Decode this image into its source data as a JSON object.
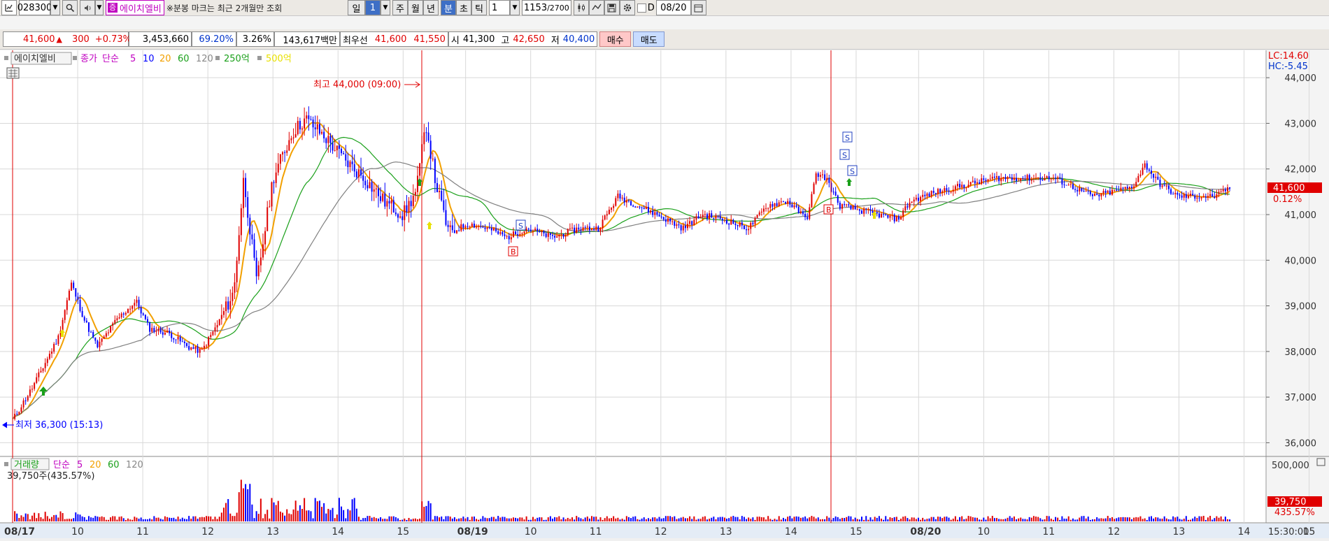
{
  "toolbar": {
    "code": "028300",
    "name": "에이치엘비",
    "notice": "※분봉 마크는 최근 2개월만 조회",
    "period_day": "일",
    "period_num": "1",
    "period_week": "주",
    "period_month": "월",
    "period_year": "년",
    "period_min": "분",
    "period_sec": "초",
    "period_tick": "틱",
    "interval_value": "1",
    "count": "1153",
    "count_total": "/2700",
    "d_label": "D",
    "date": "08/20"
  },
  "quote": {
    "price": "41,600",
    "up_arrow": "▲",
    "change": "300",
    "change_pct": "+0.73%",
    "volume": "3,453,660",
    "vol_ratio": "69.20%",
    "turnover": "3.26%",
    "amount": "143,617백만",
    "best_label": "최우선",
    "best_ask": "41,600",
    "best_bid": "41,550",
    "open_label": "시",
    "open": "41,300",
    "high_label": "고",
    "high": "42,650",
    "low_label": "저",
    "low": "40,400",
    "buy_button": "매수",
    "sell_button": "매도"
  },
  "price_legend": {
    "name": "에이치엘비",
    "close_label": "종가",
    "simple": "단순",
    "ma5": "5",
    "ma10": "10",
    "ma20": "20",
    "ma60": "60",
    "ma120": "120",
    "ma250": "250억",
    "ma500": "500억"
  },
  "volume_legend": {
    "title": "거래량",
    "simple": "단순",
    "ma5": "5",
    "ma20": "20",
    "ma60": "60",
    "ma120": "120",
    "value": "39,750주(435.57%)"
  },
  "annotations": {
    "high": "최고 44,000 (09:00)",
    "low": "최저 36,300 (15:13)",
    "lc": "LC:14.60",
    "hc": "HC:-5.45",
    "current_price": "41,600",
    "current_pct": "0.12%",
    "vol_current": "39,750",
    "vol_pct": "435.57%",
    "vol_axis_max": "500,000",
    "time_corner": "15:30:00"
  },
  "colors": {
    "up": "#e00000",
    "down": "#0000ff",
    "ma5": "#f2a000",
    "ma20": "#1aa01a",
    "ma60": "#808080",
    "grid": "#d8d8d8"
  },
  "chart_data": {
    "type": "line",
    "title": "",
    "price_axis": {
      "ticks": [
        "44,000",
        "43,000",
        "42,000",
        "41,000",
        "40,000",
        "39,000",
        "38,000",
        "37,000",
        "36,000"
      ],
      "tick_values": [
        44000,
        43000,
        42000,
        41000,
        40000,
        39000,
        38000,
        37000,
        36000
      ],
      "ylim": [
        35700,
        44600
      ]
    },
    "time_axis": {
      "labels": [
        "08/17",
        "10",
        "11",
        "12",
        "13",
        "14",
        "15",
        "08/19",
        "10",
        "11",
        "12",
        "13",
        "14",
        "15",
        "08/20",
        "10",
        "11",
        "12",
        "13",
        "14",
        "15"
      ],
      "day_starts": [
        "08/17",
        "08/19",
        "08/20"
      ]
    },
    "series_prices": [
      {
        "x": 0,
        "y": 36500
      },
      {
        "x": 0.3,
        "y": 37200
      },
      {
        "x": 0.7,
        "y": 38300
      },
      {
        "x": 0.9,
        "y": 39500
      },
      {
        "x": 1.1,
        "y": 38700
      },
      {
        "x": 1.3,
        "y": 38100
      },
      {
        "x": 1.6,
        "y": 38700
      },
      {
        "x": 1.9,
        "y": 39100
      },
      {
        "x": 2.1,
        "y": 38500
      },
      {
        "x": 2.4,
        "y": 38400
      },
      {
        "x": 2.7,
        "y": 38100
      },
      {
        "x": 2.9,
        "y": 38000
      },
      {
        "x": 3.15,
        "y": 38600
      },
      {
        "x": 3.4,
        "y": 39300
      },
      {
        "x": 3.55,
        "y": 41800
      },
      {
        "x": 3.75,
        "y": 39500
      },
      {
        "x": 4.0,
        "y": 41800
      },
      {
        "x": 4.3,
        "y": 42800
      },
      {
        "x": 4.5,
        "y": 43100
      },
      {
        "x": 4.8,
        "y": 42700
      },
      {
        "x": 5.1,
        "y": 42200
      },
      {
        "x": 5.4,
        "y": 41800
      },
      {
        "x": 5.7,
        "y": 41300
      },
      {
        "x": 6.0,
        "y": 41000
      },
      {
        "x": 6.2,
        "y": 41500
      },
      {
        "x": 6.35,
        "y": 43000
      },
      {
        "x": 6.5,
        "y": 41700
      },
      {
        "x": 6.7,
        "y": 40600
      },
      {
        "x": 7.0,
        "y": 40800
      },
      {
        "x": 7.3,
        "y": 40700
      },
      {
        "x": 7.6,
        "y": 40500
      },
      {
        "x": 7.9,
        "y": 40700
      },
      {
        "x": 8.3,
        "y": 40500
      },
      {
        "x": 8.7,
        "y": 40700
      },
      {
        "x": 9.0,
        "y": 40700
      },
      {
        "x": 9.3,
        "y": 41400
      },
      {
        "x": 9.6,
        "y": 41200
      },
      {
        "x": 9.9,
        "y": 41000
      },
      {
        "x": 10.3,
        "y": 40700
      },
      {
        "x": 10.6,
        "y": 41000
      },
      {
        "x": 10.9,
        "y": 40900
      },
      {
        "x": 11.3,
        "y": 40700
      },
      {
        "x": 11.6,
        "y": 41200
      },
      {
        "x": 11.9,
        "y": 41300
      },
      {
        "x": 12.2,
        "y": 40900
      },
      {
        "x": 12.35,
        "y": 41900
      },
      {
        "x": 12.5,
        "y": 41800
      },
      {
        "x": 12.7,
        "y": 41200
      },
      {
        "x": 13.0,
        "y": 41100
      },
      {
        "x": 13.3,
        "y": 41000
      },
      {
        "x": 13.6,
        "y": 40900
      },
      {
        "x": 13.8,
        "y": 41300
      },
      {
        "x": 14.2,
        "y": 41500
      },
      {
        "x": 14.5,
        "y": 41600
      },
      {
        "x": 14.8,
        "y": 41700
      },
      {
        "x": 15.1,
        "y": 41800
      },
      {
        "x": 15.4,
        "y": 41800
      },
      {
        "x": 15.7,
        "y": 41800
      },
      {
        "x": 16.0,
        "y": 41800
      },
      {
        "x": 16.3,
        "y": 41600
      },
      {
        "x": 16.6,
        "y": 41400
      },
      {
        "x": 16.9,
        "y": 41500
      },
      {
        "x": 17.2,
        "y": 41600
      },
      {
        "x": 17.4,
        "y": 42100
      },
      {
        "x": 17.6,
        "y": 41700
      },
      {
        "x": 17.9,
        "y": 41400
      },
      {
        "x": 18.2,
        "y": 41400
      },
      {
        "x": 18.5,
        "y": 41400
      },
      {
        "x": 18.7,
        "y": 41600
      }
    ]
  }
}
